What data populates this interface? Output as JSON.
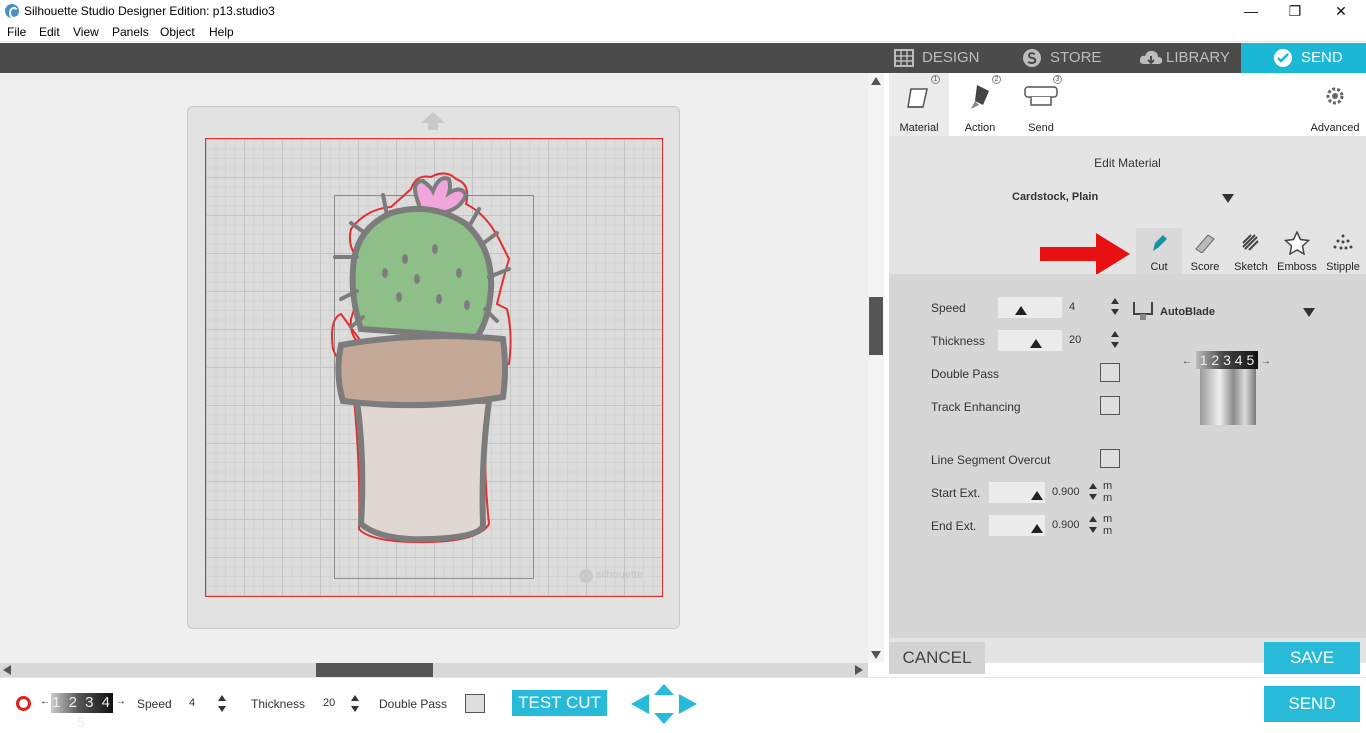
{
  "window": {
    "title": "Silhouette Studio Designer Edition: p13.studio3",
    "minimize": "—",
    "maximize": "❐",
    "close": "✕"
  },
  "menu": [
    "File",
    "Edit",
    "View",
    "Panels",
    "Object",
    "Help"
  ],
  "top_tabs": {
    "design": "DESIGN",
    "store": "STORE",
    "library": "LIBRARY",
    "send": "SEND",
    "active": "SEND"
  },
  "sub_tabs": [
    {
      "label": "Material",
      "num": "1"
    },
    {
      "label": "Action",
      "num": "2"
    },
    {
      "label": "Send",
      "num": "3"
    }
  ],
  "advanced_label": "Advanced",
  "edit_material": {
    "title": "Edit Material",
    "selected": "Cardstock, Plain"
  },
  "tools": [
    {
      "label": "Cut",
      "icon": "cut-pen-icon",
      "active": true
    },
    {
      "label": "Score",
      "icon": "score-icon"
    },
    {
      "label": "Sketch",
      "icon": "sketch-icon"
    },
    {
      "label": "Emboss",
      "icon": "star-icon"
    },
    {
      "label": "Stipple",
      "icon": "stipple-icon"
    }
  ],
  "settings": {
    "speed_label": "Speed",
    "speed_value": "4",
    "thickness_label": "Thickness",
    "thickness_value": "20",
    "double_pass_label": "Double Pass",
    "track_enhancing_label": "Track Enhancing",
    "line_segment_overcut_label": "Line Segment Overcut",
    "start_ext_label": "Start Ext.",
    "start_ext_value": "0.900",
    "end_ext_label": "End Ext.",
    "end_ext_value": "0.900",
    "unit_line1": "m",
    "unit_line2": "m",
    "blade": "AutoBlade",
    "blade_dial": "1 2 3 4 5"
  },
  "buttons": {
    "cancel": "CANCEL",
    "save": "SAVE",
    "send": "SEND",
    "test_cut": "TEST CUT"
  },
  "bottom": {
    "dial": "1 2 3 4 5",
    "speed_label": "Speed",
    "speed_value": "4",
    "thickness_label": "Thickness",
    "thickness_value": "20",
    "double_pass_label": "Double Pass"
  },
  "canvas": {
    "watermark": "silhouette"
  },
  "colors": {
    "accent": "#27bbd9",
    "dark_bar": "#4b4b4b",
    "cut_line": "#e03030",
    "cactus_green": "#8fbf88",
    "flower_pink": "#f0a5dc",
    "pot_rim": "#c4a898",
    "pot_body": "#e0d6d2",
    "outline_gray": "#7c7c7c"
  }
}
